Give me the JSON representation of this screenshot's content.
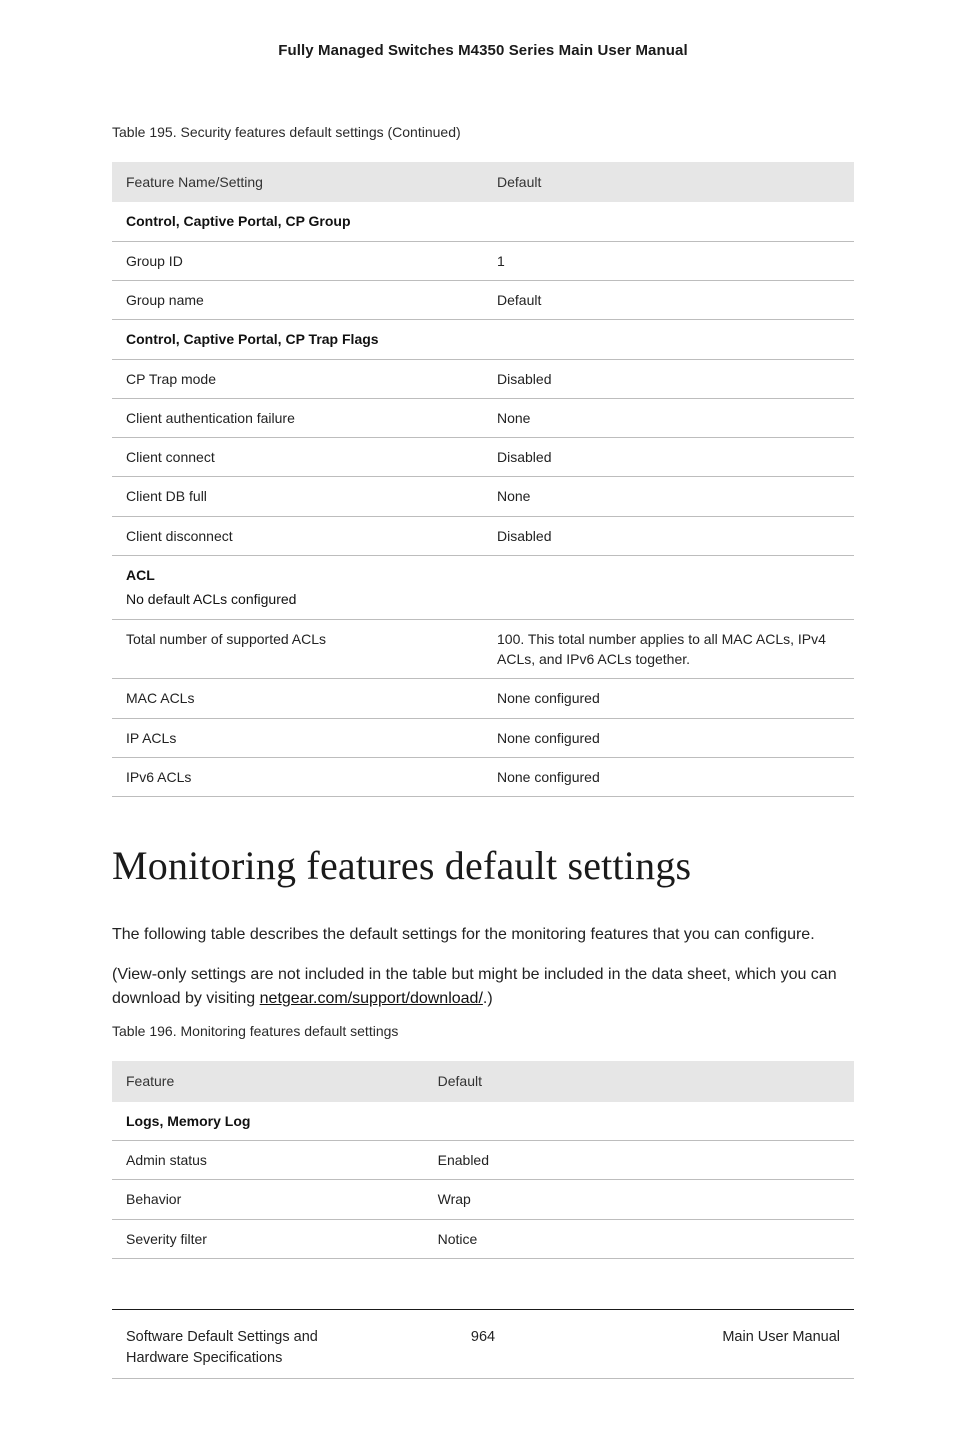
{
  "doc_title": "Fully Managed Switches M4350 Series Main User Manual",
  "table195": {
    "caption": "Table 195. Security features default settings (Continued)",
    "header": {
      "col1": "Feature Name/Setting",
      "col2": "Default"
    },
    "rows": [
      {
        "type": "section",
        "label": "Control, Captive Portal, CP Group"
      },
      {
        "type": "row",
        "name": "Group ID",
        "value": "1"
      },
      {
        "type": "row",
        "name": "Group name",
        "value": "Default"
      },
      {
        "type": "section",
        "label": "Control, Captive Portal, CP Trap Flags"
      },
      {
        "type": "row",
        "name": "CP Trap mode",
        "value": "Disabled"
      },
      {
        "type": "row",
        "name": "Client authentication failure",
        "value": "None"
      },
      {
        "type": "row",
        "name": "Client connect",
        "value": "Disabled"
      },
      {
        "type": "row",
        "name": "Client DB full",
        "value": "None"
      },
      {
        "type": "row",
        "name": "Client disconnect",
        "value": "Disabled"
      },
      {
        "type": "section",
        "label": "ACL",
        "sublabel": "No default ACLs configured"
      },
      {
        "type": "row",
        "name": "Total number of supported ACLs",
        "value": "100. This total number applies to all MAC ACLs, IPv4 ACLs, and IPv6 ACLs together."
      },
      {
        "type": "row",
        "name": "MAC ACLs",
        "value": "None configured"
      },
      {
        "type": "row",
        "name": "IP ACLs",
        "value": "None configured"
      },
      {
        "type": "row",
        "name": "IPv6 ACLs",
        "value": "None configured"
      }
    ]
  },
  "section_heading": "Monitoring features default settings",
  "para1": "The following table describes the default settings for the monitoring features that you can configure.",
  "para2_prefix": "(View-only settings are not included in the table but might be included in the data sheet, which you can download by visiting ",
  "para2_link_text": "netgear.com/support/download/",
  "para2_suffix": ".)",
  "table196": {
    "caption": "Table 196. Monitoring features default settings",
    "header": {
      "col1": "Feature",
      "col2": "Default"
    },
    "rows": [
      {
        "type": "section",
        "label": "Logs, Memory Log"
      },
      {
        "type": "row",
        "name": "Admin status",
        "value": "Enabled"
      },
      {
        "type": "row",
        "name": "Behavior",
        "value": "Wrap"
      },
      {
        "type": "row",
        "name": "Severity filter",
        "value": "Notice"
      }
    ]
  },
  "footer": {
    "left_line1": "Software Default Settings and",
    "left_line2": "Hardware Specifications",
    "page_number": "964",
    "right": "Main User Manual"
  }
}
